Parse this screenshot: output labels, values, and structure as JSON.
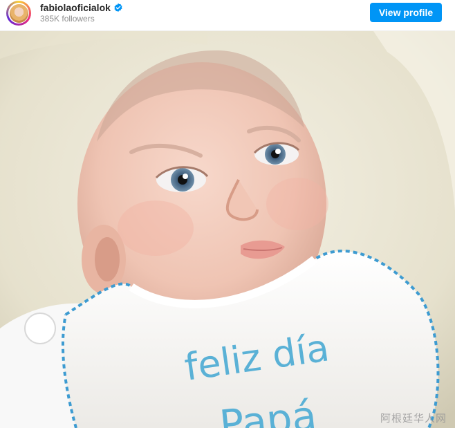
{
  "post_header": {
    "username": "fabiolaoficialok",
    "followers": "385K followers",
    "view_profile_label": "View profile",
    "verified_icon": "verified-badge-icon",
    "accent_color": "#0095f6"
  },
  "photo": {
    "bib_line1": "feliz día",
    "bib_line2": "Papá",
    "watermark": "阿根廷华人网"
  }
}
